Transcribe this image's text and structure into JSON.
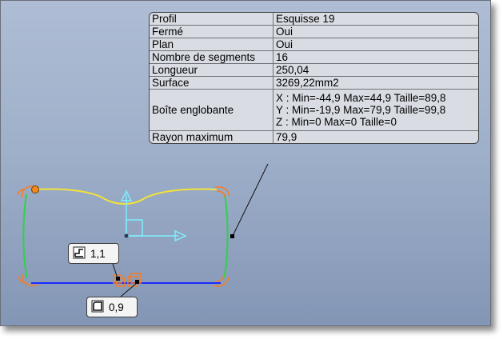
{
  "properties": {
    "rows": [
      {
        "key": "Profil",
        "value": "Esquisse 19"
      },
      {
        "key": "Fermé",
        "value": "Oui"
      },
      {
        "key": "Plan",
        "value": "Oui"
      },
      {
        "key": "Nombre de segments",
        "value": "16"
      },
      {
        "key": "Longueur",
        "value": "250,04"
      },
      {
        "key": "Surface",
        "value": "3269,22mm2"
      }
    ],
    "bounding_box": {
      "key": "Boîte englobante",
      "x": "X : Min=-44,9 Max=44,9 Taille=89,8",
      "y": "Y : Min=-19,9 Max=79,9 Taille=99,8",
      "z": "Z : Min=0 Max=0 Taille=0"
    },
    "max_radius": {
      "key": "Rayon maximum",
      "value": "79,9"
    }
  },
  "annotations": {
    "tag1": {
      "value": "1,1",
      "icon": "fillet-icon"
    },
    "tag2": {
      "value": "0,9",
      "icon": "rounded-corner-icon"
    }
  },
  "colors": {
    "top_curve": "#f2e33a",
    "side_lines": "#2fd24a",
    "bottom_line": "#1a2bff",
    "fillets": "#ff7a1a",
    "axes": "#7ff0ff",
    "background_top": "#aebdd4",
    "background_bottom": "#8396b5"
  }
}
